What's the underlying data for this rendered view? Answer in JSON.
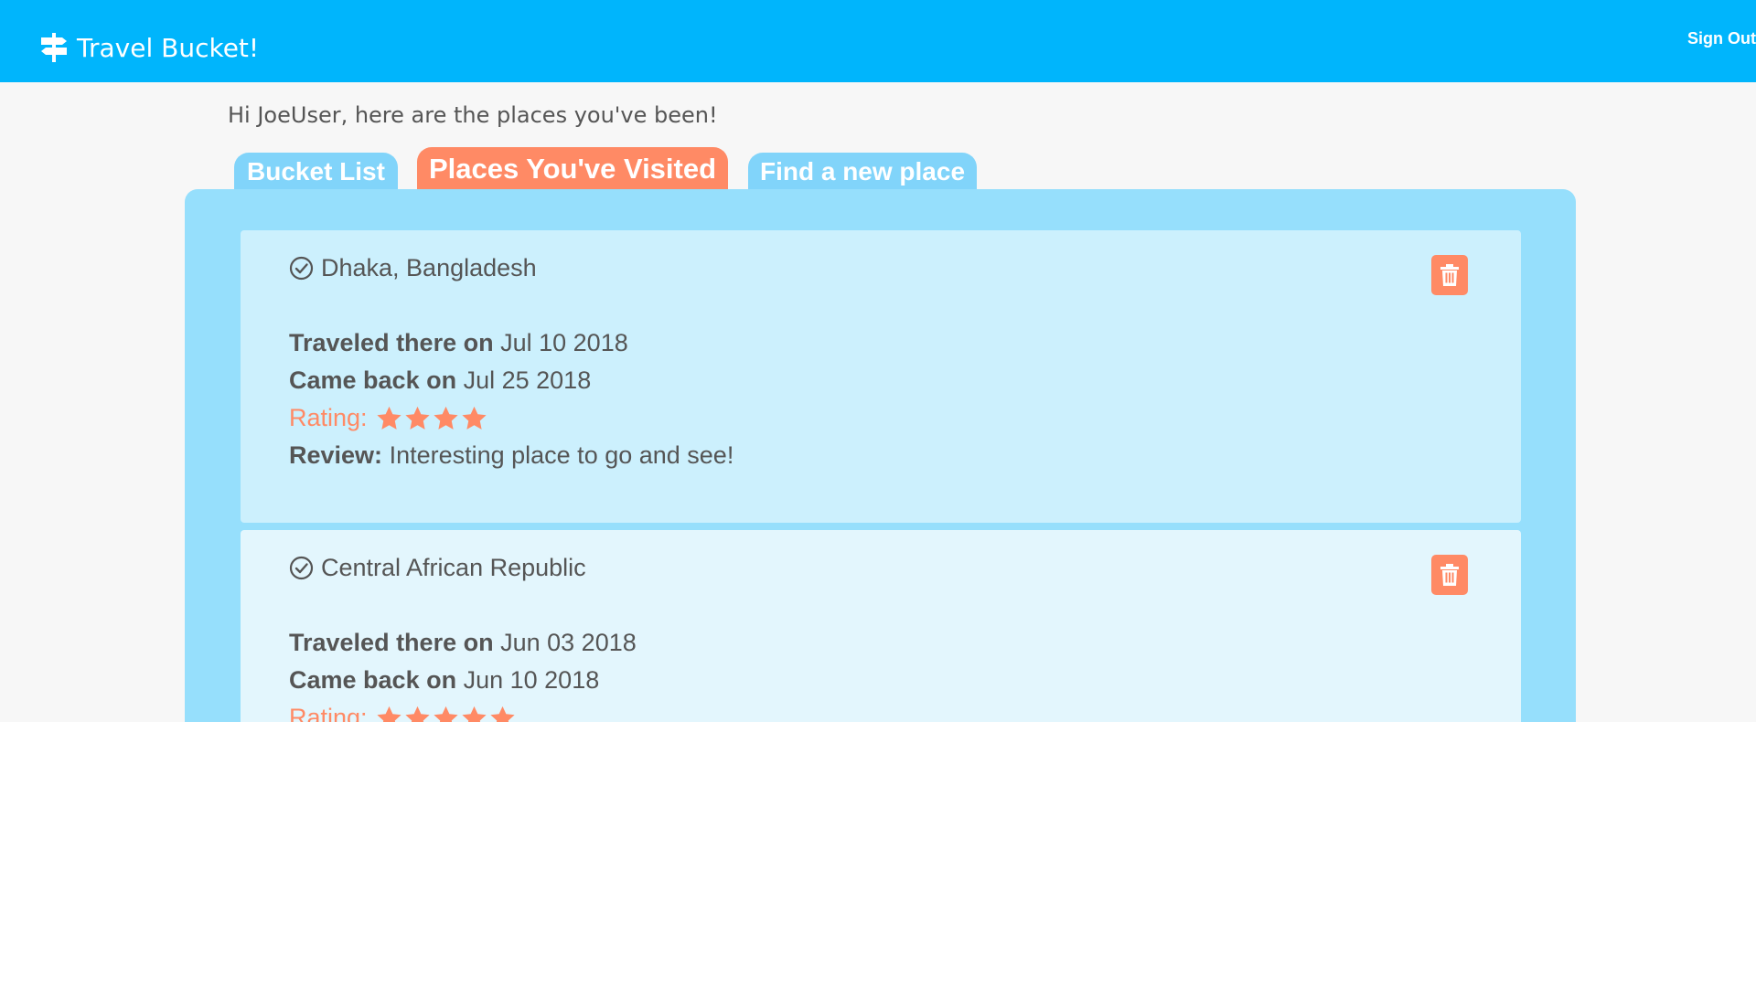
{
  "app": {
    "title": "Travel Bucket!",
    "signout_label": "Sign Out"
  },
  "greeting": "Hi JoeUser, here are the places you've been!",
  "tabs": [
    {
      "label": "Bucket List",
      "active": false
    },
    {
      "label": "Places You've Visited",
      "active": true
    },
    {
      "label": "Find a new place",
      "active": false
    }
  ],
  "labels": {
    "traveled": "Traveled there on",
    "came_back": "Came back on",
    "rating": "Rating:",
    "review": "Review:"
  },
  "places": [
    {
      "name": "Dhaka, Bangladesh",
      "traveled": "Jul 10 2018",
      "came_back": "Jul 25 2018",
      "rating": 4,
      "review": "Interesting place to go and see!"
    },
    {
      "name": "Central African Republic",
      "traveled": "Jun 03 2018",
      "came_back": "Jun 10 2018",
      "rating": 5,
      "review": ""
    }
  ],
  "icons": {
    "brand": "signpost-icon",
    "visited": "check-circle-icon",
    "delete": "trash-icon",
    "rating": "star-icon"
  },
  "colors": {
    "navbar": "#00b5fc",
    "accent": "#ff8a65",
    "tab_inactive": "#81d4fa",
    "panel": "#96dffc",
    "card_primary": "#ccf0fd",
    "card_secondary": "#e3f6fd",
    "text": "#555555"
  }
}
